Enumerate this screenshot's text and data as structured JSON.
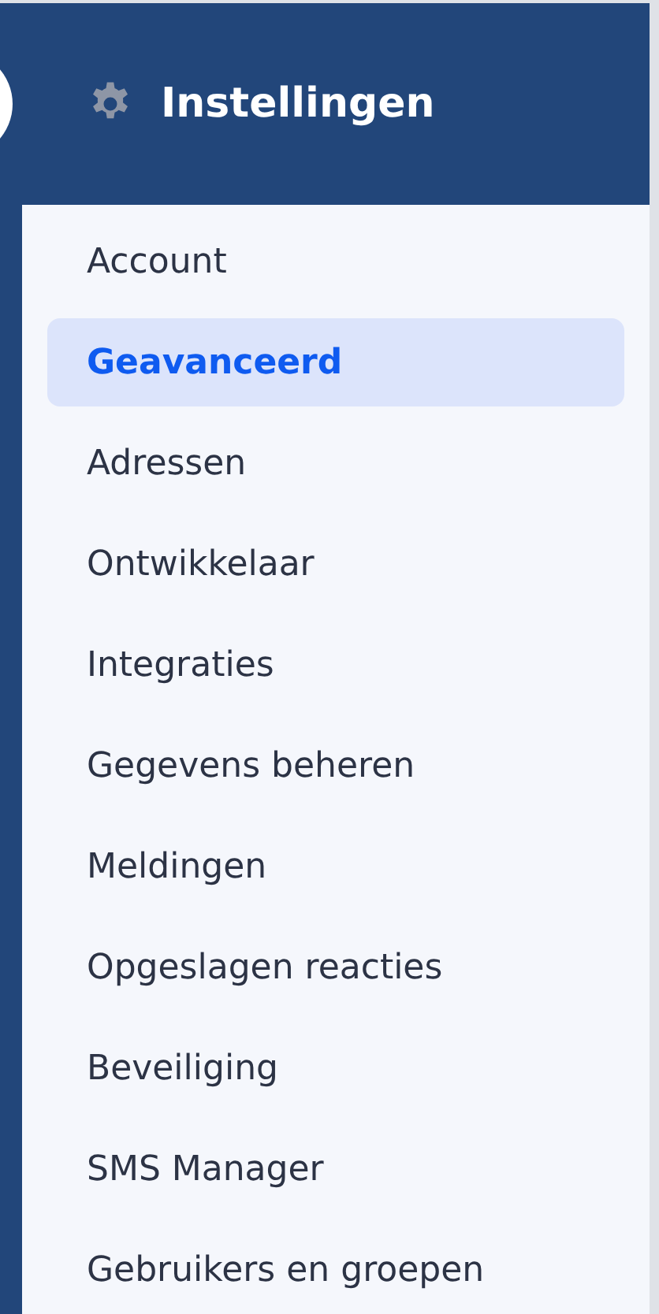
{
  "header": {
    "title": "Instellingen"
  },
  "menu": [
    {
      "label": "Account",
      "selected": false
    },
    {
      "label": "Geavanceerd",
      "selected": true
    },
    {
      "label": "Adressen",
      "selected": false
    },
    {
      "label": "Ontwikkelaar",
      "selected": false
    },
    {
      "label": "Integraties",
      "selected": false
    },
    {
      "label": "Gegevens beheren",
      "selected": false
    },
    {
      "label": "Meldingen",
      "selected": false
    },
    {
      "label": "Opgeslagen reacties",
      "selected": false
    },
    {
      "label": "Beveiliging",
      "selected": false
    },
    {
      "label": "SMS Manager",
      "selected": false
    },
    {
      "label": "Gebruikers en groepen",
      "selected": false
    }
  ]
}
